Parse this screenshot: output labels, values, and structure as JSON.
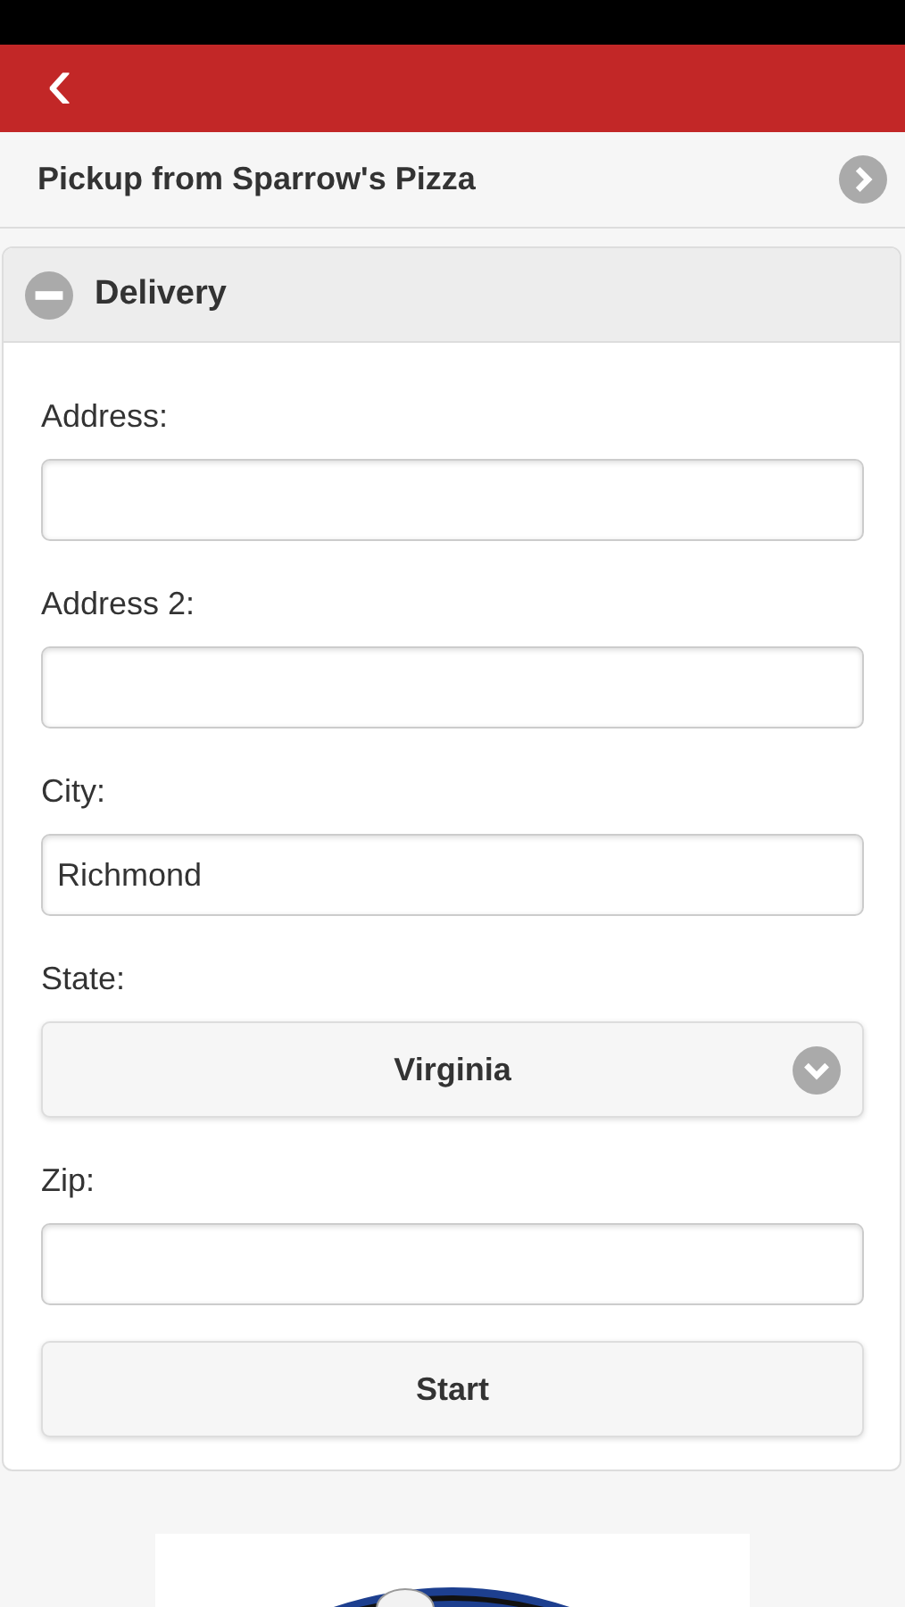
{
  "header": {
    "back": "‹"
  },
  "pickup": {
    "label": "Pickup from Sparrow's Pizza"
  },
  "delivery": {
    "title": "Delivery",
    "expanded": true,
    "fields": [
      {
        "kind": "text",
        "label": "Address:"
      },
      {
        "kind": "text",
        "label": "Address 2:"
      },
      {
        "kind": "text",
        "label": "City:",
        "value": "Richmond"
      },
      {
        "kind": "select",
        "label": "State:",
        "value": "Virginia"
      },
      {
        "kind": "text",
        "label": "Zip:"
      }
    ],
    "button": "Start"
  }
}
